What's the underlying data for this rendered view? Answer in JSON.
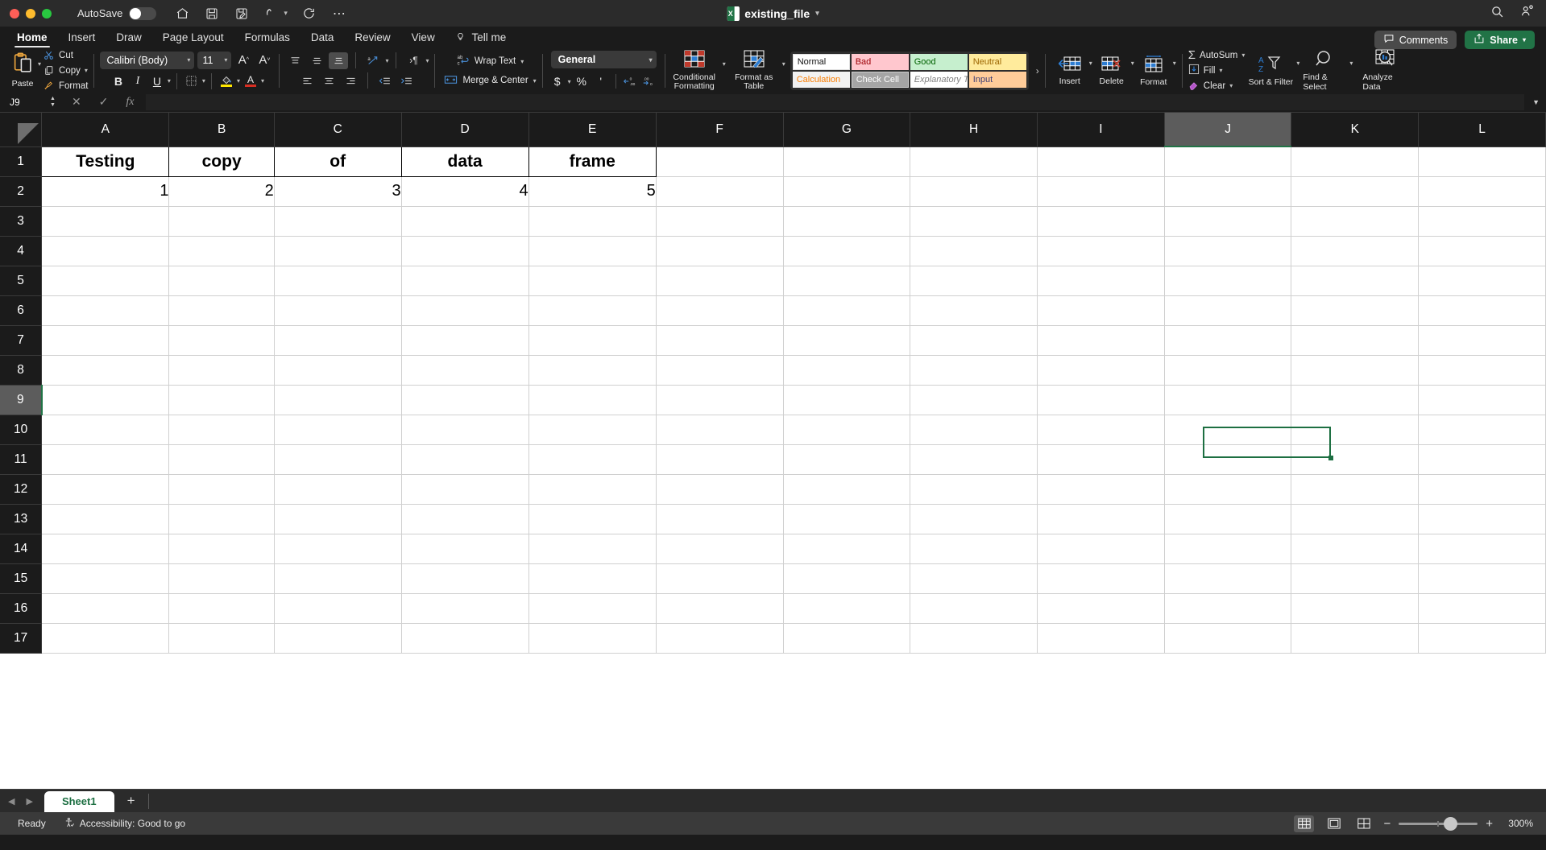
{
  "window": {
    "autosave_label": "AutoSave",
    "document_title": "existing_file"
  },
  "titlebar_right": {
    "comments_label": "Comments",
    "share_label": "Share"
  },
  "tabs": [
    {
      "label": "Home",
      "active": true
    },
    {
      "label": "Insert",
      "active": false
    },
    {
      "label": "Draw",
      "active": false
    },
    {
      "label": "Page Layout",
      "active": false
    },
    {
      "label": "Formulas",
      "active": false
    },
    {
      "label": "Data",
      "active": false
    },
    {
      "label": "Review",
      "active": false
    },
    {
      "label": "View",
      "active": false
    },
    {
      "label": "Tell me",
      "active": false
    }
  ],
  "ribbon": {
    "clipboard": {
      "paste_label": "Paste",
      "cut_label": "Cut",
      "copy_label": "Copy",
      "format_label": "Format"
    },
    "font": {
      "font_name": "Calibri (Body)",
      "font_size": "11",
      "grow_label": "A",
      "shrink_label": "A",
      "bold_label": "B",
      "italic_label": "I",
      "underline_label": "U"
    },
    "alignment": {
      "wrap_text_label": "Wrap Text",
      "merge_center_label": "Merge & Center"
    },
    "number": {
      "format_value": "General",
      "currency_label": "$",
      "percent_label": "%",
      "comma_label": "'"
    },
    "styles": {
      "conditional_formatting_label": "Conditional Formatting",
      "format_as_table_label": "Format as Table",
      "cell_styles": [
        {
          "label": "Normal",
          "class": "g-normal"
        },
        {
          "label": "Bad",
          "class": "g-bad"
        },
        {
          "label": "Good",
          "class": "g-good"
        },
        {
          "label": "Neutral",
          "class": "g-neutral"
        },
        {
          "label": "Calculation",
          "class": "g-calc"
        },
        {
          "label": "Check Cell",
          "class": "g-check"
        },
        {
          "label": "Explanatory T...",
          "class": "g-expl"
        },
        {
          "label": "Input",
          "class": "g-input"
        }
      ]
    },
    "cells": {
      "insert_label": "Insert",
      "delete_label": "Delete",
      "format_label": "Format"
    },
    "editing": {
      "autosum_label": "AutoSum",
      "fill_label": "Fill",
      "clear_label": "Clear",
      "sort_filter_label": "Sort & Filter",
      "find_select_label": "Find & Select",
      "analyze_data_label": "Analyze Data"
    }
  },
  "formula_bar": {
    "name_box": "J9",
    "formula_value": ""
  },
  "grid": {
    "columns": [
      "A",
      "B",
      "C",
      "D",
      "E",
      "F",
      "G",
      "H",
      "I",
      "J",
      "K",
      "L"
    ],
    "rows": [
      "1",
      "2",
      "3",
      "4",
      "5",
      "6",
      "7",
      "8",
      "9",
      "10",
      "11",
      "12",
      "13",
      "14",
      "15",
      "16",
      "17"
    ],
    "selected_column": "J",
    "selected_row": "9",
    "selected_cell": "J9",
    "data": [
      [
        "Testing",
        "copy",
        "of",
        "data",
        "frame",
        "",
        "",
        "",
        "",
        "",
        "",
        ""
      ],
      [
        "1",
        "2",
        "3",
        "4",
        "5",
        "",
        "",
        "",
        "",
        "",
        "",
        ""
      ]
    ],
    "accent_selection_color": "#1d6f42"
  },
  "sheet_tabs": {
    "sheets": [
      "Sheet1"
    ],
    "active_sheet": "Sheet1",
    "add_label": "+"
  },
  "status_bar": {
    "status": "Ready",
    "accessibility": "Accessibility: Good to go",
    "zoom": "300%"
  }
}
